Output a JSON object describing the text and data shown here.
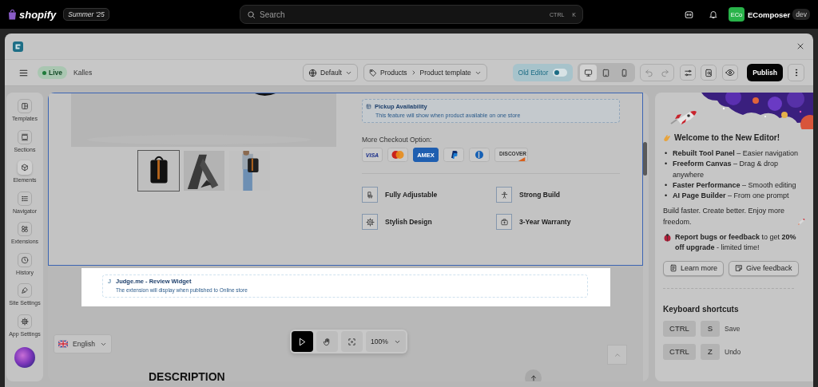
{
  "topbar": {
    "logo": "shopify",
    "edition": "Summer '25",
    "search": {
      "placeholder": "Search",
      "shortcut": [
        "CTRL",
        "K"
      ]
    },
    "store": {
      "avatar": "ECo",
      "name": "EComposer",
      "badge": "dev"
    }
  },
  "toolbar": {
    "status": "Live",
    "theme": "Kalles",
    "preset": "Default",
    "breadcrumb": [
      "Products",
      "Product template"
    ],
    "old_editor": {
      "label": "Old Editor",
      "on": false
    },
    "devices": [
      {
        "kind": "desktop",
        "selected": true
      },
      {
        "kind": "tablet",
        "selected": false
      },
      {
        "kind": "mobile",
        "selected": false
      }
    ],
    "publish": "Publish"
  },
  "sidebar": {
    "items": [
      {
        "kind": "templates",
        "label": "Templates",
        "selected": false
      },
      {
        "kind": "sections",
        "label": "Sections",
        "selected": false
      },
      {
        "kind": "elements",
        "label": "Elements",
        "selected": true
      },
      {
        "kind": "navigator",
        "label": "Navigator",
        "selected": false
      },
      {
        "kind": "extensions",
        "label": "Extensions",
        "selected": false
      },
      {
        "kind": "history",
        "label": "History",
        "selected": false
      },
      {
        "kind": "site_settings",
        "label": "Site Settings",
        "selected": false
      },
      {
        "kind": "app_settings",
        "label": "App Settings",
        "selected": false
      }
    ]
  },
  "canvas": {
    "thumbnails": [
      {
        "kind": "picture",
        "selected": true
      },
      {
        "kind": "picture",
        "selected": false
      },
      {
        "kind": "picture",
        "selected": false
      }
    ],
    "pickup": {
      "title": "Pickup Availability",
      "text": "This feature will show when product available on one store"
    },
    "checkout_label": "More Checkout Option:",
    "payments": [
      {
        "kind": "visa",
        "label": "VISA"
      },
      {
        "kind": "mastercard"
      },
      {
        "kind": "amex",
        "label": "AMEX"
      },
      {
        "kind": "paypal"
      },
      {
        "kind": "diners"
      },
      {
        "kind": "discover",
        "label": "DISCOVER"
      }
    ],
    "features": [
      {
        "kind": "seat",
        "label": "Fully Adjustable"
      },
      {
        "kind": "figure",
        "label": "Strong Build"
      },
      {
        "kind": "gear",
        "label": "Stylish Design"
      },
      {
        "kind": "briefcase",
        "label": "3-Year Warranty"
      }
    ],
    "widget": {
      "icon": "J",
      "title": "Judge.me - Review Widget",
      "text": "The extension will display when published to Online store"
    },
    "language": "English",
    "tools": [
      {
        "kind": "pointer",
        "selected": true
      },
      {
        "kind": "hand",
        "selected": false
      },
      {
        "kind": "focus",
        "selected": false
      }
    ],
    "zoom": "100%",
    "description_heading": "DESCRIPTION"
  },
  "panel": {
    "welcome": "Welcome to the New Editor!",
    "features": [
      {
        "marker": "•",
        "text": "**Rebuilt Tool Panel** – Easier navigation"
      },
      {
        "marker": "•",
        "text": "**Freeform Canvas** – Drag & drop anywhere"
      },
      {
        "marker": "•",
        "text": "**Faster Performance** – Smooth editing"
      },
      {
        "marker": "•",
        "text": "**AI Page Builder** – From one prompt"
      }
    ],
    "tagline": "Build faster. Create better. Enjoy more freedom.",
    "promo": "**Report bugs or feedback** to get **20% off upgrade** - limited time!",
    "buttons": [
      {
        "kind": "learn",
        "label": "Learn more"
      },
      {
        "kind": "feedback",
        "label": "Give feedback"
      }
    ],
    "shortcuts_title": "Keyboard shortcuts",
    "shortcuts": [
      {
        "keys": [
          "CTRL",
          "S"
        ],
        "action": "Save"
      },
      {
        "keys": [
          "CTRL",
          "Z"
        ],
        "action": "Undo"
      }
    ]
  }
}
